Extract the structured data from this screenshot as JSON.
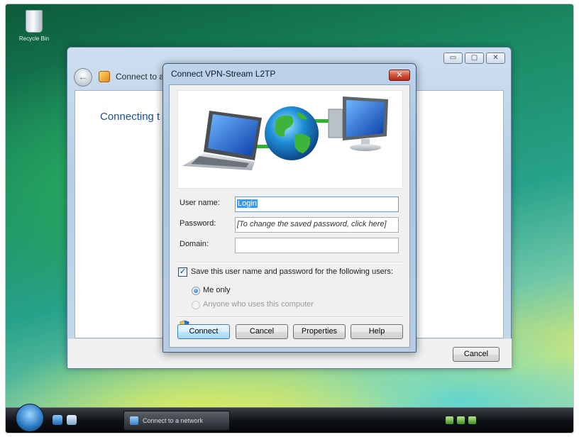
{
  "desktop": {
    "recycle_bin_label": "Recycle Bin"
  },
  "taskbar": {
    "task_button_label": "Connect to a network"
  },
  "wizard": {
    "title": "Connect to a",
    "connecting_text": "Connecting t",
    "controls": {
      "minimize": "▭",
      "maximize": "▢",
      "close": "✕"
    },
    "back_glyph": "←",
    "cancel_label": "Cancel"
  },
  "dialog": {
    "title": "Connect VPN-Stream L2TP",
    "close_glyph": "✕",
    "form": {
      "username_label": "User name:",
      "username_value": "Login",
      "password_label": "Password:",
      "password_value": "[To change the saved password, click here]",
      "domain_label": "Domain:",
      "domain_value": ""
    },
    "save_checkbox": {
      "label": "Save this user name and password for the following users:",
      "checked": true
    },
    "radios": [
      {
        "label": "Me only",
        "selected": true,
        "enabled": true
      },
      {
        "label": "Anyone who uses this computer",
        "selected": false,
        "enabled": false
      }
    ],
    "buttons": {
      "connect": "Connect",
      "cancel": "Cancel",
      "properties": "Properties",
      "help": "Help"
    }
  },
  "icons": {
    "banner": "laptop-globe-monitor-illustration",
    "shield": "uac-shield-icon",
    "checkbox_mark": "✓"
  },
  "colors": {
    "accent_blue": "#3399ff",
    "wizard_heading": "#1f4f8f",
    "close_red": "#d2533d",
    "globe_green": "#2fb32f"
  }
}
